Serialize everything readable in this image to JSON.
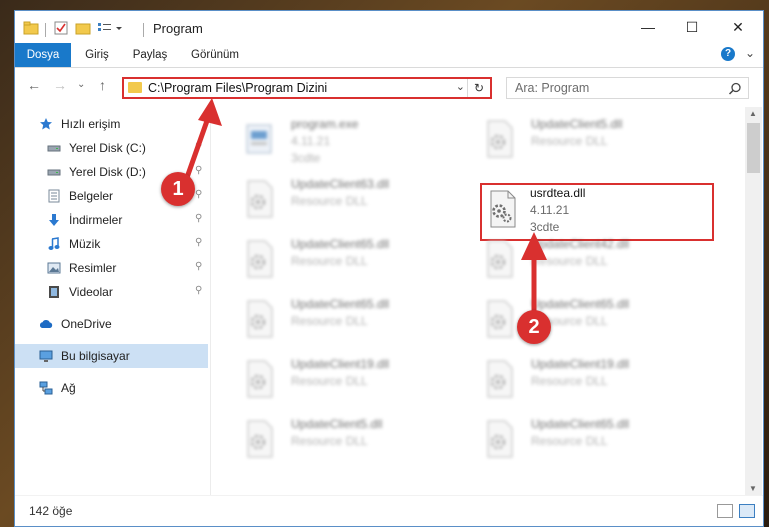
{
  "window": {
    "title": "Program",
    "accent": "#1979ca",
    "highlight": "#d9302f",
    "controls": {
      "minimize": "—",
      "maximize": "☐",
      "close": "✕"
    }
  },
  "ribbon": {
    "tabs": [
      "Dosya",
      "Giriş",
      "Paylaş",
      "Görünüm"
    ],
    "help": "?",
    "collapse": "⌄"
  },
  "nav": {
    "back": "←",
    "forward": "→",
    "recent": "⌄",
    "up": "↑"
  },
  "address": {
    "path": "C:\\Program Files\\Program Dizini",
    "dropdown": "⌄",
    "refresh": "↻"
  },
  "search": {
    "placeholder": "Ara: Program",
    "icon": "search-icon"
  },
  "sidebar": {
    "items": [
      {
        "label": "Hızlı erişim",
        "icon": "star-icon",
        "pinned": false
      },
      {
        "label": "Yerel Disk (C:)",
        "icon": "drive-icon",
        "pinned": true
      },
      {
        "label": "Yerel Disk (D:)",
        "icon": "drive-icon",
        "pinned": true
      },
      {
        "label": "Belgeler",
        "icon": "documents-icon",
        "pinned": true
      },
      {
        "label": "İndirmeler",
        "icon": "download-icon",
        "pinned": true
      },
      {
        "label": "Müzik",
        "icon": "music-icon",
        "pinned": true
      },
      {
        "label": "Resimler",
        "icon": "pictures-icon",
        "pinned": true
      },
      {
        "label": "Videolar",
        "icon": "video-icon",
        "pinned": true
      },
      {
        "label": "OneDrive",
        "icon": "cloud-icon",
        "pinned": false
      },
      {
        "label": "Bu bilgisayar",
        "icon": "computer-icon",
        "pinned": false,
        "selected": true
      },
      {
        "label": "Ağ",
        "icon": "network-icon",
        "pinned": false
      }
    ],
    "pin_glyph": "📌"
  },
  "files": [
    {
      "name": "program.exe",
      "line2": "4.11.21",
      "line3": "3cdte",
      "kind": "exe"
    },
    {
      "name": "UpdateClient5.dll",
      "line2": "Resource DLL",
      "line3": "",
      "kind": "dll"
    },
    {
      "name": "UpdateClient63.dll",
      "line2": "Resource DLL",
      "line3": "",
      "kind": "dll"
    },
    {
      "name": "usrdtea.dll",
      "line2": "4.11.21",
      "line3": "3cdte",
      "kind": "dll",
      "highlighted": true
    },
    {
      "name": "UpdateClient65.dll",
      "line2": "Resource DLL",
      "line3": "",
      "kind": "dll"
    },
    {
      "name": "UpdateClient42.dll",
      "line2": "Resource DLL",
      "line3": "",
      "kind": "dll"
    },
    {
      "name": "UpdateClient65.dll",
      "line2": "Resource DLL",
      "line3": "",
      "kind": "dll"
    },
    {
      "name": "UpdateClient65.dll",
      "line2": "Resource DLL",
      "line3": "",
      "kind": "dll"
    },
    {
      "name": "UpdateClient19.dll",
      "line2": "Resource DLL",
      "line3": "",
      "kind": "dll"
    },
    {
      "name": "UpdateClient19.dll",
      "line2": "Resource DLL",
      "line3": "",
      "kind": "dll"
    },
    {
      "name": "UpdateClient5.dll",
      "line2": "Resource DLL",
      "line3": "",
      "kind": "dll"
    },
    {
      "name": "UpdateClient65.dll",
      "line2": "Resource DLL",
      "line3": "",
      "kind": "dll"
    }
  ],
  "status": {
    "item_count": "142 öğe"
  },
  "annotations": [
    {
      "number": "1",
      "target": "address-bar"
    },
    {
      "number": "2",
      "target": "usrdtea.dll"
    }
  ]
}
